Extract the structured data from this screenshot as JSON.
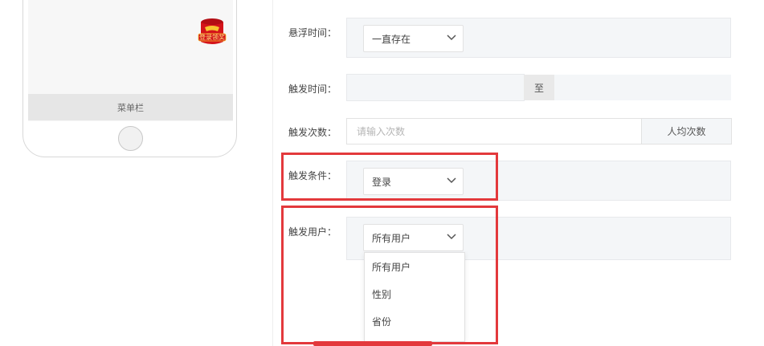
{
  "phone": {
    "menu_bar_label": "菜单栏",
    "float_badge_text": "登录领奖",
    "float_badge_color": "#d4141b"
  },
  "form": {
    "float_time": {
      "label": "悬浮时间：",
      "value": "一直存在"
    },
    "trigger_time": {
      "label": "触发时间：",
      "separator": "至"
    },
    "trigger_count": {
      "label": "触发次数：",
      "placeholder": "请输入次数",
      "suffix": "人均次数"
    },
    "trigger_condition": {
      "label": "触发条件：",
      "value": "登录"
    },
    "trigger_user": {
      "label": "触发用户：",
      "value": "所有用户",
      "options": [
        "所有用户",
        "性别",
        "省份"
      ]
    }
  },
  "colors": {
    "highlight": "#e3393c",
    "panel_bg": "#f4f6f8"
  }
}
